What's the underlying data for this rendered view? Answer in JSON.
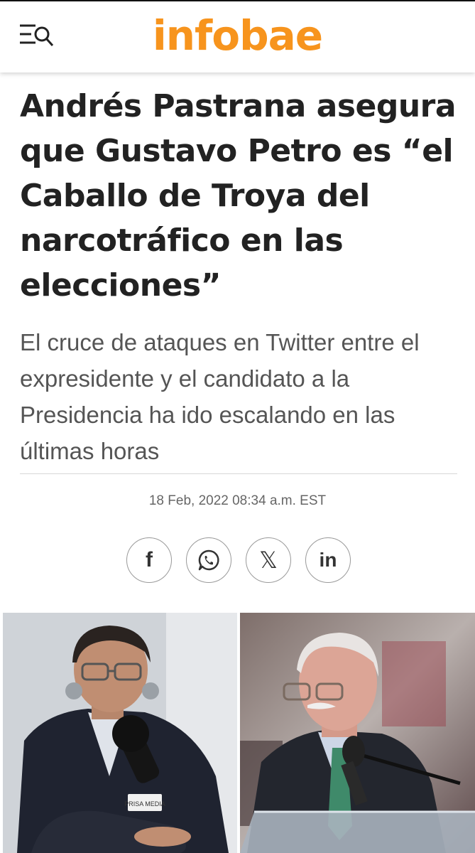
{
  "header": {
    "logo": "infobae",
    "menu_icon": "menu-search-icon",
    "logo_color": "#f7941d"
  },
  "article": {
    "headline": "Andrés Pastrana asegura que Gustavo Petro es “el Caballo de Troya del narcotráfico en las elecciones”",
    "subtitle": "El cruce de ataques en Twitter entre el expresidente y el candidato a la Presidencia ha ido escalando en las últimas horas",
    "timestamp": "18 Feb, 2022 08:34 a.m. EST"
  },
  "share": [
    {
      "icon": "facebook-icon",
      "label": "f"
    },
    {
      "icon": "whatsapp-icon"
    },
    {
      "icon": "x-icon",
      "label": "𝕏"
    },
    {
      "icon": "linkedin-icon",
      "label": "in"
    }
  ],
  "photos": [
    {
      "subject": "gustavo-petro-photo",
      "mic_flag": "PRISA MEDIA"
    },
    {
      "subject": "andres-pastrana-photo"
    }
  ]
}
